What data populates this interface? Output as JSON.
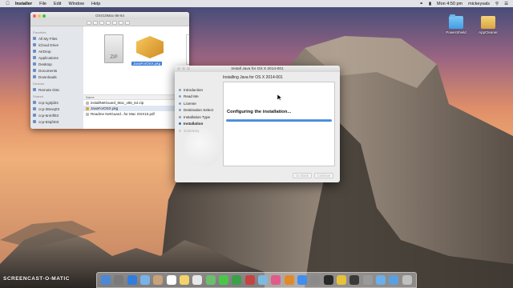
{
  "menubar": {
    "app": "Installer",
    "items": [
      "File",
      "Edit",
      "Window",
      "Help"
    ],
    "clock": "Mon 4:50 pm",
    "user": "mickeysals"
  },
  "desktop_icons": [
    {
      "label": "PowerShield",
      "icon": "folder-icon"
    },
    {
      "label": "AppCleaner",
      "icon": "package-icon"
    }
  ],
  "finder": {
    "title": "OSX10Mac-86-64",
    "sidebar": {
      "favorites_head": "Favorites",
      "favorites": [
        "All My Files",
        "iCloud Drive",
        "AirDrop",
        "Applications",
        "Desktop",
        "Documents",
        "Downloads"
      ],
      "devices_head": "Devices",
      "devices": [
        "Remote Disc"
      ],
      "shared_head": "Shared",
      "shared": [
        "ccp-1g4jd2s",
        "ccp-38vvq03",
        "ccp-6nmfl03",
        "ccp-93qf403"
      ]
    },
    "preview": {
      "zip_label": "ZIP",
      "pkg_label": "JavaForOSX.pkg"
    },
    "list": {
      "name_header": "Name",
      "rows": [
        {
          "name": "installNetGuard_Mac_x86_64.zip",
          "size": "14.1"
        },
        {
          "name": "JavaForOSX.pkg",
          "size": "14.1"
        },
        {
          "name": "Readme NetGuard...for Mac OSX10.pdf",
          "size": "14"
        }
      ],
      "selected_index": 1
    }
  },
  "installer": {
    "title": "Install Java for OS X 2014-001",
    "heading": "Installing Java for OS X 2014-001",
    "steps": [
      {
        "label": "Introduction",
        "state": "done"
      },
      {
        "label": "Read Me",
        "state": "done"
      },
      {
        "label": "License",
        "state": "done"
      },
      {
        "label": "Destination Select",
        "state": "done"
      },
      {
        "label": "Installation Type",
        "state": "done"
      },
      {
        "label": "Installation",
        "state": "current"
      },
      {
        "label": "Summary",
        "state": "future"
      }
    ],
    "status": "Configuring the installation...",
    "progress": 1.0,
    "go_back_label": "Go Back",
    "continue_label": "Continue"
  },
  "dock": {
    "apps": [
      "finder",
      "launchpad",
      "safari",
      "mail",
      "contacts",
      "calendar",
      "notes",
      "reminders",
      "maps",
      "messages",
      "facetime",
      "photo-booth",
      "iphoto",
      "itunes",
      "ibooks",
      "app-store",
      "system-preferences",
      "terminal",
      "chrome",
      "activity-monitor",
      "screenshot",
      "folder",
      "downloads",
      "trash"
    ],
    "colors": [
      "#4b89d8",
      "#7a7a7a",
      "#2f7de0",
      "#7ab2e8",
      "#c9a27a",
      "#ffffff",
      "#f3d36a",
      "#e8e8e8",
      "#6bbf6b",
      "#4cc64a",
      "#3aa04a",
      "#c74242",
      "#7fb8e0",
      "#e05a8c",
      "#e08a2a",
      "#3f8ef0",
      "#8a8a8a",
      "#2a2a2a",
      "#e9c23b",
      "#3a3a3a",
      "#9a9a9a",
      "#6aaeea",
      "#5aa0e0",
      "#c0c0c0"
    ]
  },
  "watermark": "SCREENCAST-O-MATIC"
}
